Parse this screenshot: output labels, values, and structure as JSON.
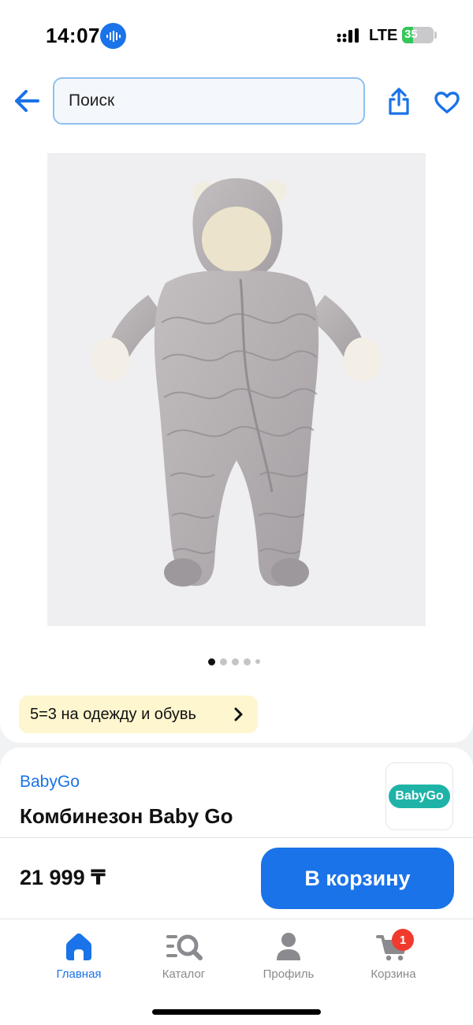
{
  "status_bar": {
    "time": "14:07",
    "network": "LTE",
    "battery": "35",
    "battery_level": 0.35
  },
  "header": {
    "search_placeholder": "Поиск",
    "back_icon": "arrow-left-icon",
    "share_icon": "share-icon",
    "favorite_icon": "heart-icon"
  },
  "gallery": {
    "image": "grey-baby-snowsuit-photo",
    "pages": 5,
    "active_page": 1
  },
  "promo": {
    "label": "5=3 на одежду и обувь"
  },
  "product": {
    "brand": "BabyGo",
    "title": "Комбинезон Baby Go",
    "logo_text": "BabyGo"
  },
  "purchase": {
    "price": "21 999 ₸",
    "add_to_cart": "В корзину"
  },
  "tab_bar": {
    "items": [
      {
        "label": "Главная",
        "icon": "home-icon",
        "active": true
      },
      {
        "label": "Каталог",
        "icon": "catalog-search-icon",
        "active": false
      },
      {
        "label": "Профиль",
        "icon": "profile-icon",
        "active": false
      },
      {
        "label": "Корзина",
        "icon": "cart-icon",
        "active": false,
        "badge": "1"
      }
    ]
  },
  "colors": {
    "accent": "#1a73e8",
    "promo_bg": "#fdf6cf",
    "badge": "#f03a2e",
    "brand_logo": "#1fb3a8"
  }
}
